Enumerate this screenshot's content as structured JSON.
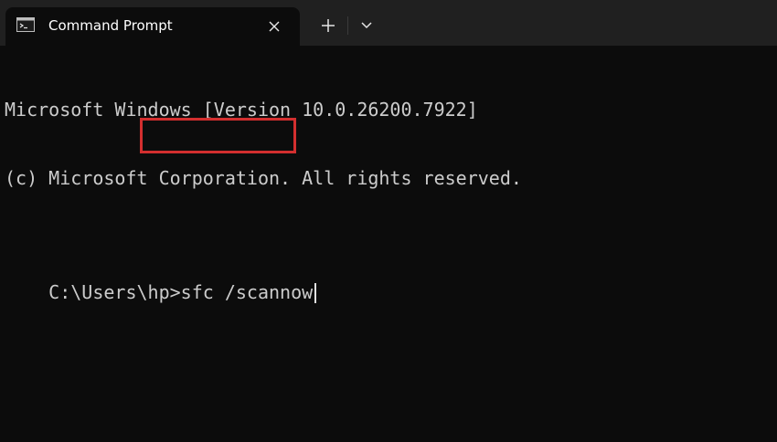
{
  "tab": {
    "title": "Command Prompt",
    "icon": "cmd-icon"
  },
  "controls": {
    "new_tab_icon": "plus-icon",
    "dropdown_icon": "chevron-down-icon",
    "close_icon": "close-icon"
  },
  "terminal": {
    "lines": [
      "Microsoft Windows [Version 10.0.26200.7922]",
      "(c) Microsoft Corporation. All rights reserved.",
      ""
    ],
    "prompt": "C:\\Users\\hp>",
    "command": "sfc /scannow"
  },
  "colors": {
    "background": "#0c0c0c",
    "tabbar": "#202020",
    "text": "#cccccc",
    "highlight": "#d32f2f"
  }
}
